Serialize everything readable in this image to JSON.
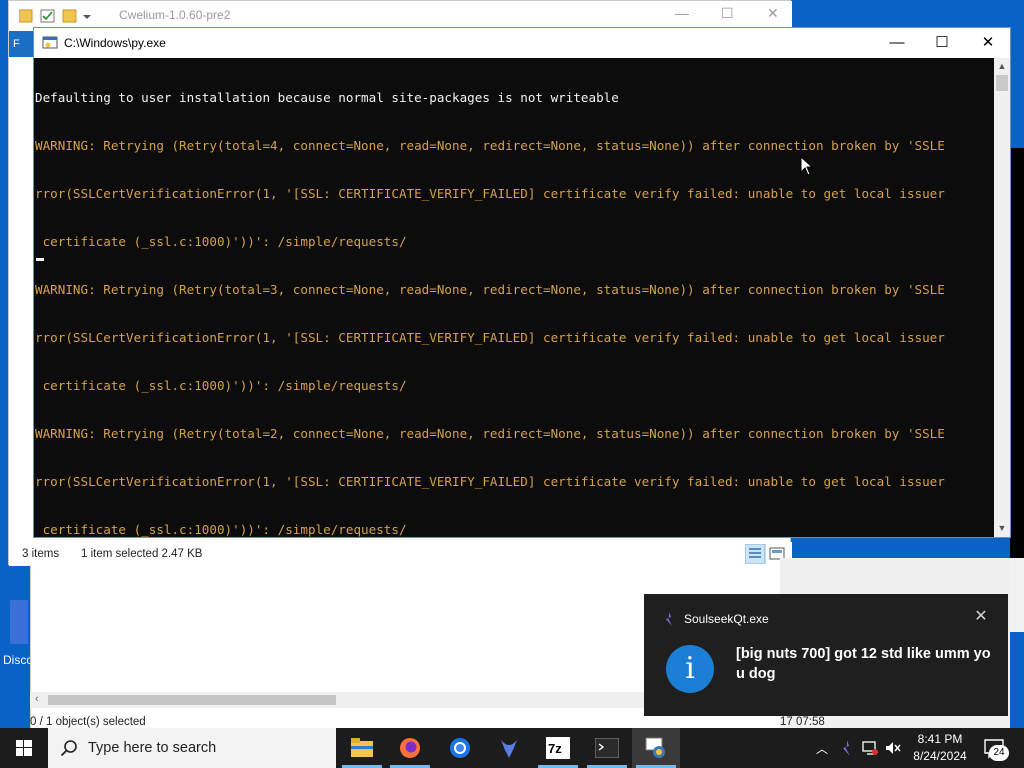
{
  "explorer_back": {
    "title": "Cwelium-1.0.60-pre2",
    "ribbon_letter": "F",
    "status_items": "3 items",
    "status_selected": "1 item selected  2.47 KB"
  },
  "explorer_lower": {
    "status": "0 / 1 object(s) selected",
    "time": "17 07:58"
  },
  "desktop_icon_label": "Disco",
  "console": {
    "title": "C:\\Windows\\py.exe",
    "lines": [
      "Defaulting to user installation because normal site-packages is not writeable",
      "WARNING: Retrying (Retry(total=4, connect=None, read=None, redirect=None, status=None)) after connection broken by 'SSLE",
      "rror(SSLCertVerificationError(1, '[SSL: CERTIFICATE_VERIFY_FAILED] certificate verify failed: unable to get local issuer",
      " certificate (_ssl.c:1000)'))': /simple/requests/",
      "WARNING: Retrying (Retry(total=3, connect=None, read=None, redirect=None, status=None)) after connection broken by 'SSLE",
      "rror(SSLCertVerificationError(1, '[SSL: CERTIFICATE_VERIFY_FAILED] certificate verify failed: unable to get local issuer",
      " certificate (_ssl.c:1000)'))': /simple/requests/",
      "WARNING: Retrying (Retry(total=2, connect=None, read=None, redirect=None, status=None)) after connection broken by 'SSLE",
      "rror(SSLCertVerificationError(1, '[SSL: CERTIFICATE_VERIFY_FAILED] certificate verify failed: unable to get local issuer",
      " certificate (_ssl.c:1000)'))': /simple/requests/"
    ],
    "line_colors": [
      "white",
      "amber",
      "amber",
      "amber",
      "amber",
      "amber",
      "amber",
      "amber",
      "amber",
      "amber"
    ]
  },
  "toast": {
    "app_name": "SoulseekQt.exe",
    "message": "[big nuts 700] got 12 std like umm you dog",
    "info_glyph": "i"
  },
  "taskbar": {
    "search_placeholder": "Type here to search",
    "time": "8:41 PM",
    "date": "8/24/2024",
    "notification_count": "24",
    "apps": [
      "file-explorer",
      "firefox",
      "chrome",
      "soulseek",
      "7zip",
      "terminal",
      "python"
    ]
  },
  "colors": {
    "console_bg": "#0c0c0c",
    "console_warning": "#d6a04a",
    "console_text": "#f2f2f2",
    "toast_bg": "#1f1f1f",
    "info_blue": "#1c7fd6",
    "taskbar_bg": "#1c1c1c",
    "desktop_blue": "#0a62c7"
  }
}
